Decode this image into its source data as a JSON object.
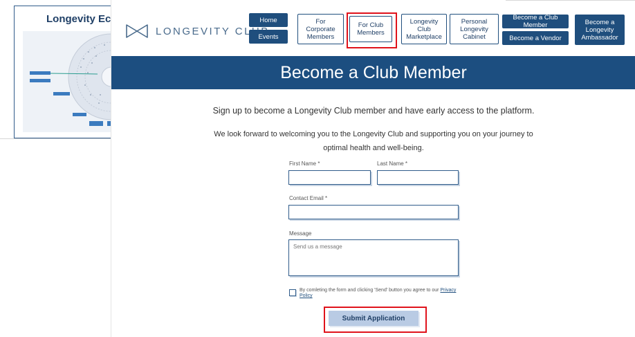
{
  "background_card": {
    "title": "Longevity Ec"
  },
  "header": {
    "logo_text": "LONGEVITY CLUB",
    "nav": {
      "home": "Home",
      "events": "Events",
      "for_corporate": "For Corporate Members",
      "for_club": "For Club Members",
      "marketplace": "Longevity Club Marketplace",
      "cabinet": "Personal Longevity Cabinet",
      "become_member": "Become a Club Member",
      "become_vendor": "Become a Vendor",
      "become_ambassador": "Become a Longevity Ambassador"
    }
  },
  "banner": {
    "title": "Become a Club Member"
  },
  "intro": {
    "line1": "Sign up to become a Longevity Club member and have early access to the platform.",
    "line2a": "We look forward to welcoming you to the Longevity Club and supporting you on your journey to",
    "line2b": "optimal health and well-being."
  },
  "form": {
    "first_name_label": "First Name *",
    "first_name_value": "",
    "last_name_label": "Last Name *",
    "last_name_value": "",
    "email_label": "Contact Email *",
    "email_value": "",
    "message_label": "Message",
    "message_placeholder": "Send us a message",
    "consent_prefix": "By comleting the form and clicking 'Send' button you agree to our ",
    "privacy_link": "Privacy Policy",
    "submit_label": "Submit Application"
  },
  "colors": {
    "brand_navy": "#1c4e80",
    "highlight_red": "#e0121b",
    "submit_bg": "#b9cbe4"
  },
  "icons": {
    "logo": "bowtie-logo-icon",
    "checkbox": "checkbox-unchecked-icon"
  }
}
